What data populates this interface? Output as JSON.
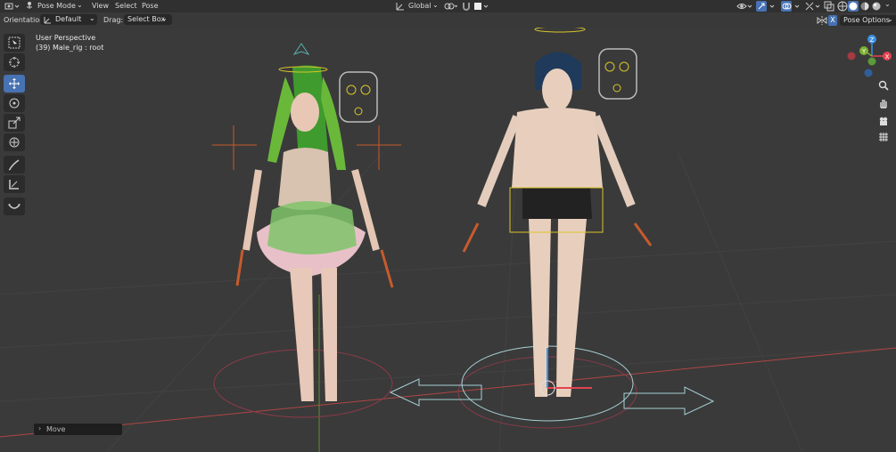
{
  "header": {
    "mode": "Pose Mode",
    "menu": [
      "View",
      "Select",
      "Pose"
    ],
    "transform_orientation": "Global",
    "pose_options": "Pose Options",
    "x_mirror": "X"
  },
  "toolsettings": {
    "orientation_label": "Orientation:",
    "orientation_value": "Default",
    "drag_label": "Drag:",
    "drag_value": "Select Box"
  },
  "viewport": {
    "view_name": "User Perspective",
    "active_object": "(39) Male_rig : root"
  },
  "gizmo": {
    "x": "X",
    "y": "Y",
    "z": "Z"
  },
  "operator_panel": {
    "label": "Move"
  },
  "tools": [
    "select-box",
    "cursor",
    "move",
    "rotate",
    "scale",
    "transform",
    "annotate",
    "measure",
    "relax-pose"
  ],
  "colors": {
    "accent": "#4772b3",
    "axis_x": "#e2434f",
    "axis_y": "#7bb032",
    "axis_z": "#3d8fe2",
    "bone_select": "#d4c32a"
  }
}
